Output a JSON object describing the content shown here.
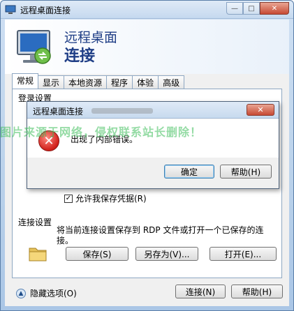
{
  "window": {
    "title": "远程桌面连接",
    "controls": {
      "minimize": "—",
      "maximize": "□",
      "close": "✕"
    }
  },
  "header": {
    "line1": "远程桌面",
    "line2": "连接"
  },
  "tabs": [
    {
      "label": "常规",
      "active": true
    },
    {
      "label": "显示"
    },
    {
      "label": "本地资源"
    },
    {
      "label": "程序"
    },
    {
      "label": "体验"
    },
    {
      "label": "高级"
    }
  ],
  "general": {
    "login_settings_label": "登录设置",
    "save_credentials_label": "允许我保存凭据(R)",
    "save_credentials_checked": true,
    "connection_settings_label": "连接设置",
    "connection_description": "将当前连接设置保存到 RDP 文件或打开一个已保存的连接。",
    "save_button": "保存(S)",
    "save_as_button": "另存为(V)...",
    "open_button": "打开(E)..."
  },
  "footer": {
    "hide_options": "隐藏选项(O)",
    "connect_button": "连接(N)",
    "help_button": "帮助(H)"
  },
  "watermark": "图片来源于网络，侵权联系站长删除！",
  "error_dialog": {
    "title": "远程桌面连接",
    "close": "✕",
    "message": "出现了内部错误。",
    "ok_button": "确定",
    "help_button": "帮助(H)"
  }
}
